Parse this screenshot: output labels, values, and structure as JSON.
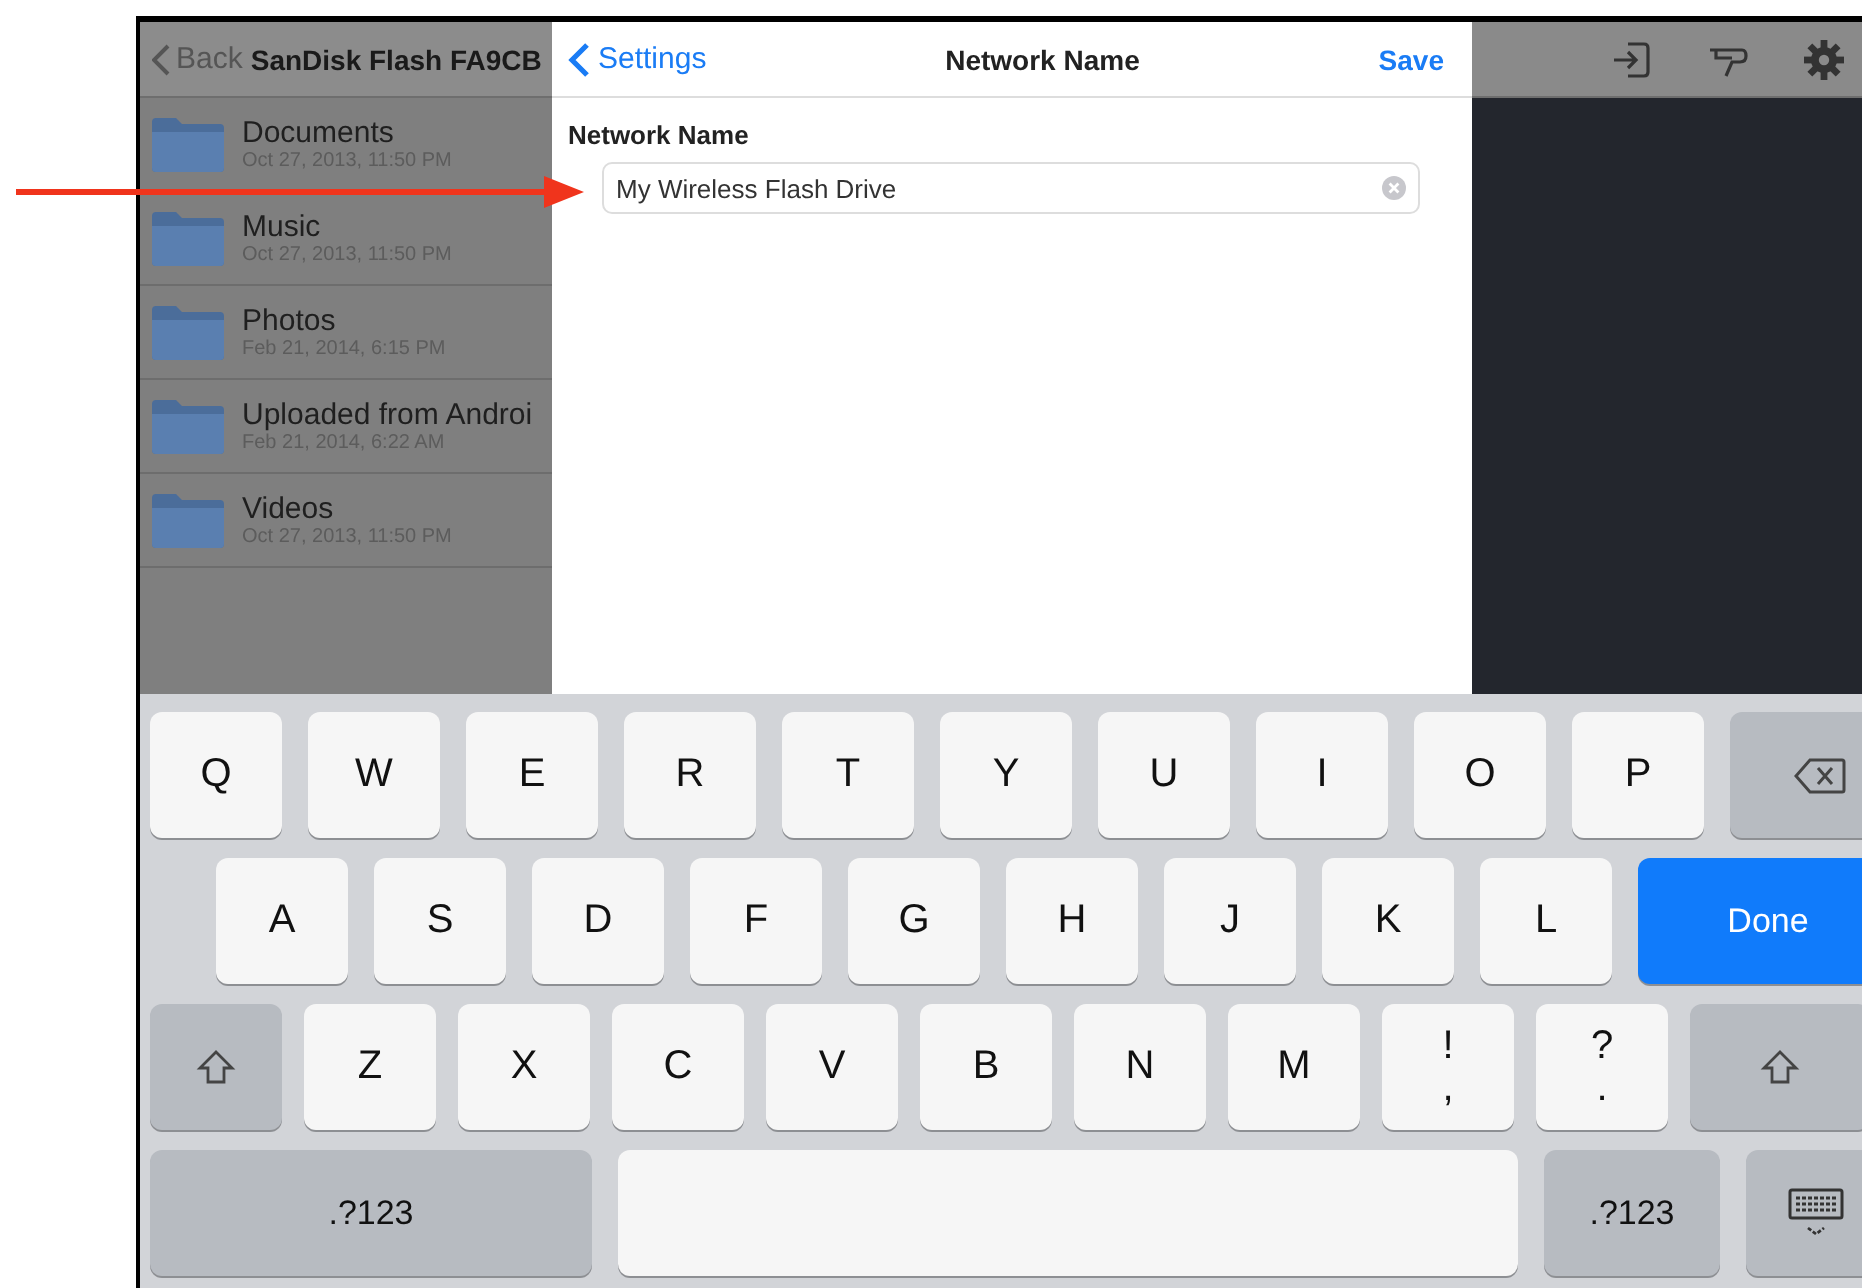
{
  "file_browser": {
    "back": "Back",
    "title": "SanDisk Flash FA9CB",
    "folders": [
      {
        "name": "Documents",
        "date": "Oct 27, 2013, 11:50 PM"
      },
      {
        "name": "Music",
        "date": "Oct 27, 2013, 11:50 PM"
      },
      {
        "name": "Photos",
        "date": "Feb 21, 2014, 6:15 PM"
      },
      {
        "name": "Uploaded from Androi",
        "date": "Feb 21, 2014, 6:22 AM"
      },
      {
        "name": "Videos",
        "date": "Oct 27, 2013, 11:50 PM"
      }
    ]
  },
  "settings_sheet": {
    "back": "Settings",
    "title": "Network Name",
    "action": "Save",
    "section_label": "Network Name",
    "field": {
      "value": "My Wireless Flash Drive"
    }
  },
  "keyboard": {
    "rows": [
      {
        "keys": [
          {
            "kind": "letter",
            "label": "Q"
          },
          {
            "kind": "letter",
            "label": "W"
          },
          {
            "kind": "letter",
            "label": "E"
          },
          {
            "kind": "letter",
            "label": "R"
          },
          {
            "kind": "letter",
            "label": "T"
          },
          {
            "kind": "letter",
            "label": "Y"
          },
          {
            "kind": "letter",
            "label": "U"
          },
          {
            "kind": "letter",
            "label": "I"
          },
          {
            "kind": "letter",
            "label": "O"
          },
          {
            "kind": "letter",
            "label": "P"
          },
          {
            "kind": "backspace"
          }
        ]
      },
      {
        "keys": [
          {
            "kind": "letter",
            "label": "A"
          },
          {
            "kind": "letter",
            "label": "S"
          },
          {
            "kind": "letter",
            "label": "D"
          },
          {
            "kind": "letter",
            "label": "F"
          },
          {
            "kind": "letter",
            "label": "G"
          },
          {
            "kind": "letter",
            "label": "H"
          },
          {
            "kind": "letter",
            "label": "J"
          },
          {
            "kind": "letter",
            "label": "K"
          },
          {
            "kind": "letter",
            "label": "L"
          },
          {
            "kind": "done",
            "label": "Done"
          }
        ]
      },
      {
        "keys": [
          {
            "kind": "shift"
          },
          {
            "kind": "letter",
            "label": "Z"
          },
          {
            "kind": "letter",
            "label": "X"
          },
          {
            "kind": "letter",
            "label": "C"
          },
          {
            "kind": "letter",
            "label": "V"
          },
          {
            "kind": "letter",
            "label": "B"
          },
          {
            "kind": "letter",
            "label": "N"
          },
          {
            "kind": "letter",
            "label": "M"
          },
          {
            "kind": "punct",
            "label": "!",
            "alt": ","
          },
          {
            "kind": "punct",
            "label": "?",
            "alt": "."
          },
          {
            "kind": "shift_wide"
          }
        ]
      },
      {
        "keys": [
          {
            "kind": "symbols",
            "label": ".?123"
          },
          {
            "kind": "space"
          },
          {
            "kind": "symbols_small",
            "label": ".?123"
          },
          {
            "kind": "dismiss"
          }
        ]
      }
    ]
  }
}
